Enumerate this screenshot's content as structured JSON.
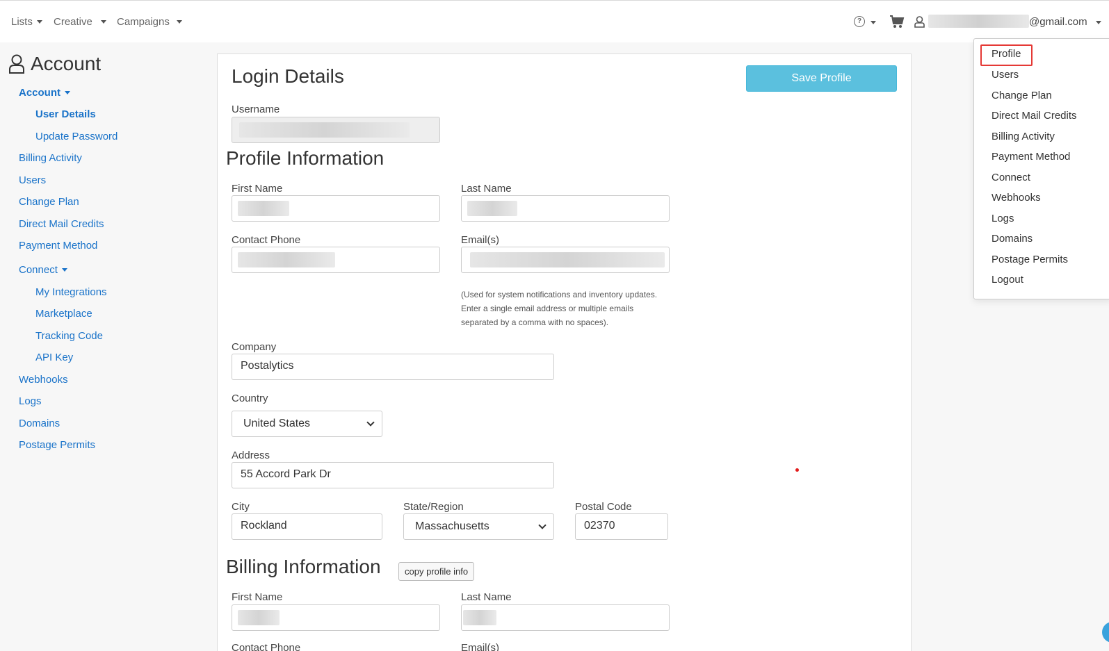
{
  "topnav": {
    "lists": "Lists",
    "creative": "Creative",
    "campaigns": "Campaigns",
    "email_suffix": "@gmail.com"
  },
  "sidebar": {
    "title": "Account",
    "items": [
      {
        "label": "Account"
      },
      {
        "label": "User Details"
      },
      {
        "label": "Update Password"
      },
      {
        "label": "Billing Activity"
      },
      {
        "label": "Users"
      },
      {
        "label": "Change Plan"
      },
      {
        "label": "Direct Mail Credits"
      },
      {
        "label": "Payment Method"
      },
      {
        "label": "Connect"
      },
      {
        "label": "My Integrations"
      },
      {
        "label": "Marketplace"
      },
      {
        "label": "Tracking Code"
      },
      {
        "label": "API Key"
      },
      {
        "label": "Webhooks"
      },
      {
        "label": "Logs"
      },
      {
        "label": "Domains"
      },
      {
        "label": "Postage Permits"
      }
    ]
  },
  "main": {
    "login_heading": "Login Details",
    "save_label": "Save Profile",
    "username_label": "Username",
    "profile_heading": "Profile Information",
    "first_name_label": "First Name",
    "last_name_label": "Last Name",
    "phone_label": "Contact Phone",
    "emails_label": "Email(s)",
    "emails_hint": "(Used for system notifications and inventory updates. Enter a single email address or multiple emails separated by a comma with no spaces).",
    "company_label": "Company",
    "company_value": "Postalytics",
    "country_label": "Country",
    "country_value": "United States",
    "address_label": "Address",
    "address_value": "55 Accord Park Dr",
    "city_label": "City",
    "city_value": "Rockland",
    "state_label": "State/Region",
    "state_value": "Massachusetts",
    "postal_label": "Postal Code",
    "postal_value": "02370",
    "billing_heading": "Billing Information",
    "copy_label": "copy profile info",
    "billing_first_label": "First Name",
    "billing_last_label": "Last Name",
    "billing_phone_label": "Contact Phone",
    "billing_emails_label": "Email(s)"
  },
  "dropdown": {
    "items": [
      {
        "label": "Profile"
      },
      {
        "label": "Users"
      },
      {
        "label": "Change Plan"
      },
      {
        "label": "Direct Mail Credits"
      },
      {
        "label": "Billing Activity"
      },
      {
        "label": "Payment Method"
      },
      {
        "label": "Connect"
      },
      {
        "label": "Webhooks"
      },
      {
        "label": "Logs"
      },
      {
        "label": "Domains"
      },
      {
        "label": "Postage Permits"
      },
      {
        "label": "Logout"
      }
    ]
  },
  "colors": {
    "link": "#1a73c9",
    "save_button": "#5bc0de",
    "highlight": "#e53935"
  }
}
